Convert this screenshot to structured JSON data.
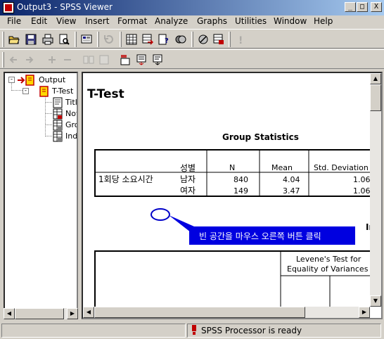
{
  "window": {
    "title": "Output3 - SPSS Viewer",
    "min_label": "_",
    "max_label": "□",
    "close_label": "X"
  },
  "menu": [
    "File",
    "Edit",
    "View",
    "Insert",
    "Format",
    "Analyze",
    "Graphs",
    "Utilities",
    "Window",
    "Help"
  ],
  "toolbar1_icons": [
    "open-icon",
    "save-icon",
    "print-icon",
    "print-preview-icon",
    "export-icon",
    "dialog-recall-icon",
    "undo-icon",
    "goto-data-icon",
    "goto-case-icon",
    "variables-icon",
    "use-sets-icon",
    "insert-case-icon",
    "help-icon"
  ],
  "toolbar2_icons": [
    "promote-icon",
    "demote-icon",
    "expand-icon",
    "collapse-icon",
    "show-icon",
    "hide-icon",
    "insert-heading-icon",
    "insert-title-icon",
    "insert-text-icon"
  ],
  "tree": {
    "items": [
      {
        "label": "Output"
      },
      {
        "label": "T-Test"
      },
      {
        "label": "Title"
      },
      {
        "label": "Notes"
      },
      {
        "label": "Group Statistics"
      },
      {
        "label": "Independent Samples Test"
      }
    ]
  },
  "content": {
    "title": "T-Test",
    "group_stats_caption": "Group Statistics",
    "group_stats": {
      "header_group": "성별",
      "col_n": "N",
      "col_mean": "Mean",
      "col_sd": "Std. Deviation",
      "row_variable": "1회당 소요시간",
      "rows": [
        {
          "group": "남자",
          "n": "840",
          "mean": "4.04",
          "sd": "1.06"
        },
        {
          "group": "여자",
          "n": "149",
          "mean": "3.47",
          "sd": "1.06"
        }
      ]
    },
    "annotation_text": "빈 공간을 마우스 오른쪽 버튼 클릭",
    "independent_label": "In",
    "levene_header_line1": "Levene's Test for",
    "levene_header_line2": "Equality of Variances"
  },
  "status": {
    "text": "SPSS Processor  is ready"
  }
}
